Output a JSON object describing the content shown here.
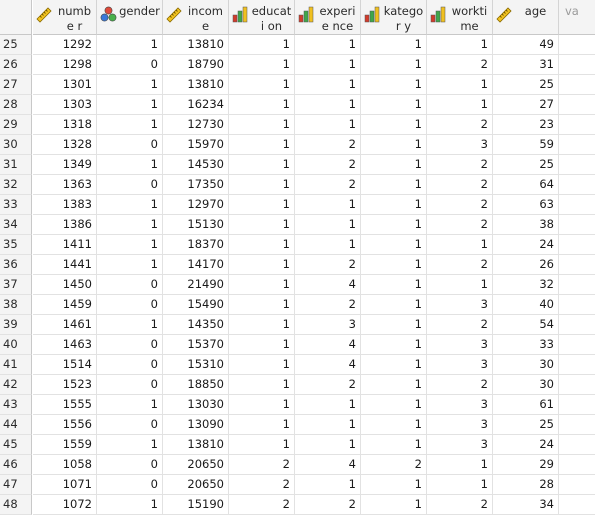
{
  "columns": [
    {
      "name": "numbe r",
      "icon": "ruler-scale-icon"
    },
    {
      "name": "gender",
      "icon": "nominal-circles-icon"
    },
    {
      "name": "income",
      "icon": "ruler-scale-icon"
    },
    {
      "name": "educati on",
      "icon": "ordinal-bars-icon"
    },
    {
      "name": "experie nce",
      "icon": "ordinal-bars-icon"
    },
    {
      "name": "kategor y",
      "icon": "ordinal-bars-icon"
    },
    {
      "name": "workti me",
      "icon": "ordinal-bars-icon"
    },
    {
      "name": "age",
      "icon": "ruler-scale-icon"
    },
    {
      "name": "va",
      "icon": ""
    }
  ],
  "rows": [
    {
      "n": "25",
      "v": [
        "1292",
        "1",
        "13810",
        "1",
        "1",
        "1",
        "1",
        "49"
      ]
    },
    {
      "n": "26",
      "v": [
        "1298",
        "0",
        "18790",
        "1",
        "1",
        "1",
        "2",
        "31"
      ]
    },
    {
      "n": "27",
      "v": [
        "1301",
        "1",
        "13810",
        "1",
        "1",
        "1",
        "1",
        "25"
      ]
    },
    {
      "n": "28",
      "v": [
        "1303",
        "1",
        "16234",
        "1",
        "1",
        "1",
        "1",
        "27"
      ]
    },
    {
      "n": "29",
      "v": [
        "1318",
        "1",
        "12730",
        "1",
        "1",
        "1",
        "2",
        "23"
      ]
    },
    {
      "n": "30",
      "v": [
        "1328",
        "0",
        "15970",
        "1",
        "2",
        "1",
        "3",
        "59"
      ]
    },
    {
      "n": "31",
      "v": [
        "1349",
        "1",
        "14530",
        "1",
        "2",
        "1",
        "2",
        "25"
      ]
    },
    {
      "n": "32",
      "v": [
        "1363",
        "0",
        "17350",
        "1",
        "2",
        "1",
        "2",
        "64"
      ]
    },
    {
      "n": "33",
      "v": [
        "1383",
        "1",
        "12970",
        "1",
        "1",
        "1",
        "2",
        "63"
      ]
    },
    {
      "n": "34",
      "v": [
        "1386",
        "1",
        "15130",
        "1",
        "1",
        "1",
        "2",
        "38"
      ]
    },
    {
      "n": "35",
      "v": [
        "1411",
        "1",
        "18370",
        "1",
        "1",
        "1",
        "1",
        "24"
      ]
    },
    {
      "n": "36",
      "v": [
        "1441",
        "1",
        "14170",
        "1",
        "2",
        "1",
        "2",
        "26"
      ]
    },
    {
      "n": "37",
      "v": [
        "1450",
        "0",
        "21490",
        "1",
        "4",
        "1",
        "1",
        "32"
      ]
    },
    {
      "n": "38",
      "v": [
        "1459",
        "0",
        "15490",
        "1",
        "2",
        "1",
        "3",
        "40"
      ]
    },
    {
      "n": "39",
      "v": [
        "1461",
        "1",
        "14350",
        "1",
        "3",
        "1",
        "2",
        "54"
      ]
    },
    {
      "n": "40",
      "v": [
        "1463",
        "0",
        "15370",
        "1",
        "4",
        "1",
        "3",
        "33"
      ]
    },
    {
      "n": "41",
      "v": [
        "1514",
        "0",
        "15310",
        "1",
        "4",
        "1",
        "3",
        "30"
      ]
    },
    {
      "n": "42",
      "v": [
        "1523",
        "0",
        "18850",
        "1",
        "2",
        "1",
        "2",
        "30"
      ]
    },
    {
      "n": "43",
      "v": [
        "1555",
        "1",
        "13030",
        "1",
        "1",
        "1",
        "3",
        "61"
      ]
    },
    {
      "n": "44",
      "v": [
        "1556",
        "0",
        "13090",
        "1",
        "1",
        "1",
        "3",
        "25"
      ]
    },
    {
      "n": "45",
      "v": [
        "1559",
        "1",
        "13810",
        "1",
        "1",
        "1",
        "3",
        "24"
      ]
    },
    {
      "n": "46",
      "v": [
        "1058",
        "0",
        "20650",
        "2",
        "4",
        "2",
        "1",
        "29"
      ]
    },
    {
      "n": "47",
      "v": [
        "1071",
        "0",
        "20650",
        "2",
        "1",
        "1",
        "1",
        "28"
      ]
    },
    {
      "n": "48",
      "v": [
        "1072",
        "1",
        "15190",
        "2",
        "2",
        "1",
        "2",
        "34"
      ]
    }
  ]
}
